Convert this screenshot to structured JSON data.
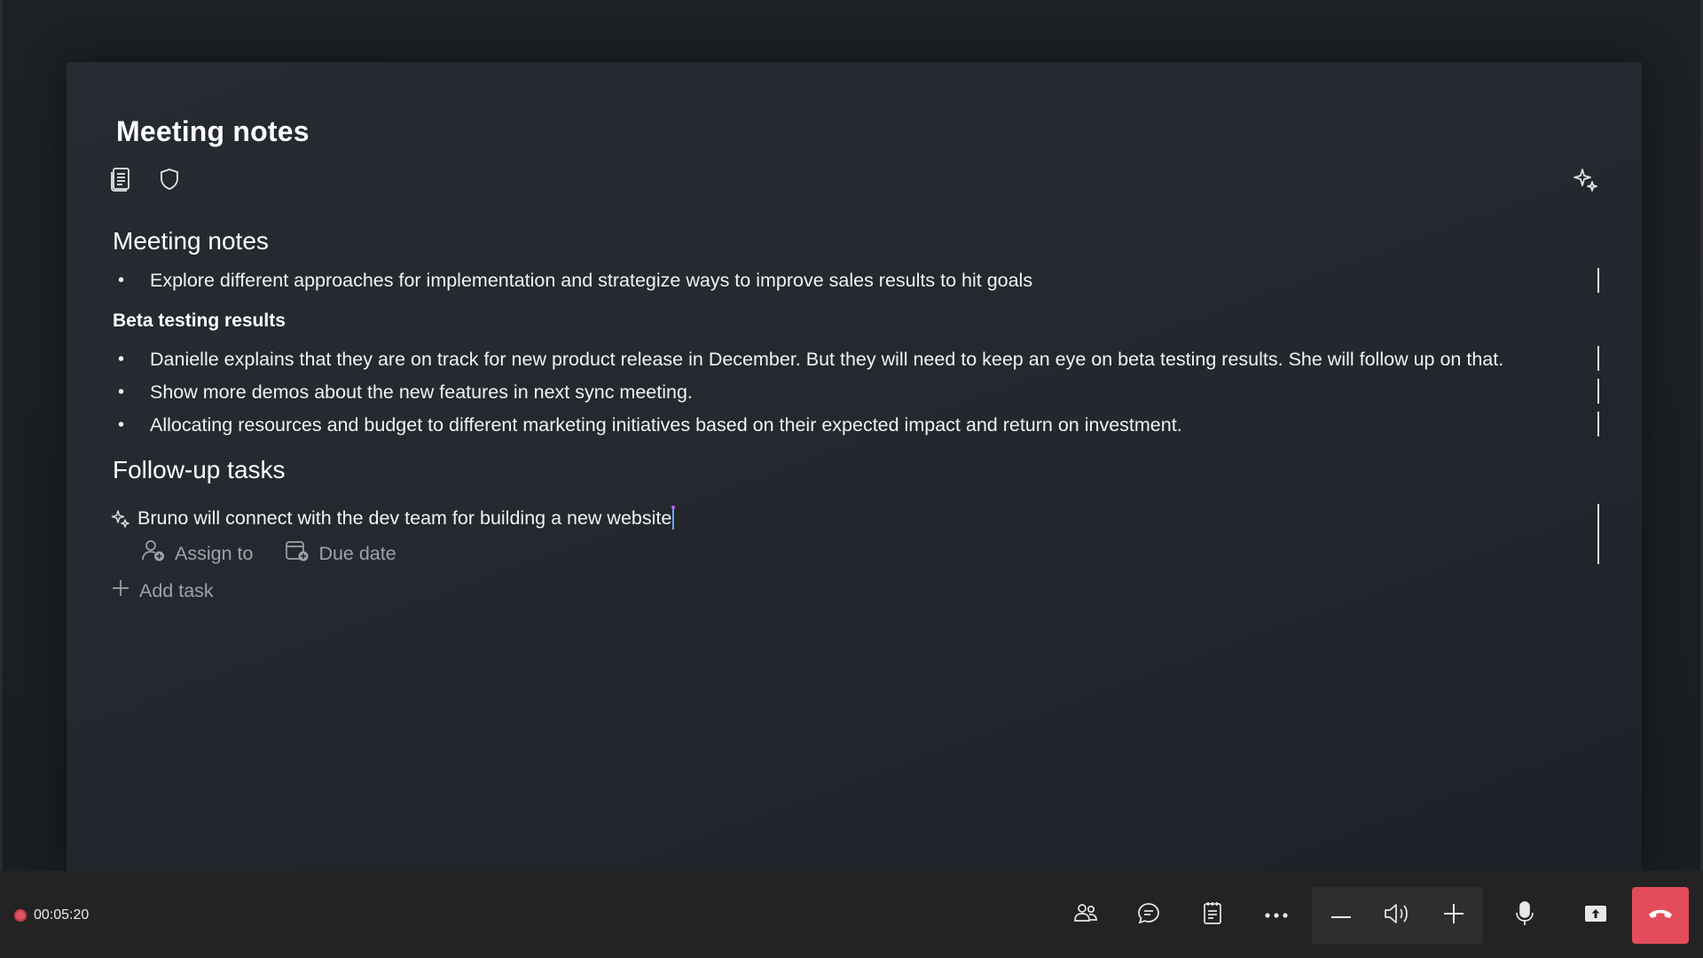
{
  "panel": {
    "title": "Meeting notes"
  },
  "notes": {
    "heading": "Meeting notes",
    "intro_bullets": [
      "Explore different approaches for implementation and strategize ways to improve sales results to hit goals"
    ],
    "subsection": {
      "heading": "Beta testing results",
      "bullets": [
        "Danielle explains that they are on track for new product release in December. But they will need to keep an eye on beta testing results. She will follow up on that.",
        "Show more demos about the new features in next sync meeting.",
        "Allocating resources and budget to different marketing initiatives based on their expected impact and return on investment."
      ]
    }
  },
  "followup": {
    "heading": "Follow-up tasks",
    "task_text": "Bruno will connect with the dev team for building a new website",
    "assign_label": "Assign to",
    "due_label": "Due date",
    "add_task_label": "Add task"
  },
  "callbar": {
    "recording_time": "00:05:20"
  },
  "colors": {
    "hangup": "#e34c5b",
    "record": "#e05561",
    "caret": "#6aa5ff"
  },
  "icons": {
    "toolbar": [
      "notes-icon",
      "shield-icon"
    ],
    "copilot": "sparkle-icon",
    "callbar": [
      "people-icon",
      "chat-icon",
      "notes-icon",
      "more-icon",
      "volume-down-icon",
      "speaker-icon",
      "volume-up-icon",
      "microphone-icon",
      "share-screen-icon",
      "hang-up-icon"
    ]
  }
}
